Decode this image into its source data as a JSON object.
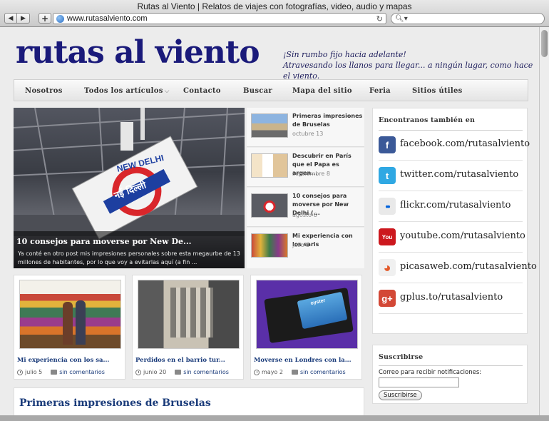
{
  "browser": {
    "window_title": "Rutas al Viento | Relatos de viajes con fotografías, video, audio y mapas",
    "url": "www.rutasalviento.com",
    "back_icon": "back-arrow-icon",
    "forward_icon": "forward-arrow-icon"
  },
  "site": {
    "title": "rutas al viento",
    "tagline_1": "¡Sin rumbo fijo hacia adelante!",
    "tagline_2": "Atravesando los llanos para llegar...  a ningún lugar, como hace el viento.",
    "title_color": "#1a1a7a"
  },
  "menu": {
    "nosotros": "Nosotros",
    "todos": "Todos los artículos",
    "contacto": "Contacto",
    "buscar": "Buscar",
    "mapa": "Mapa del sitio",
    "feria": "Feria",
    "sitios": "Sitios útiles"
  },
  "hero": {
    "sign_top": "NEW DELHI",
    "sign_hindi": "नई दिल्ली",
    "title": "10 consejos para moverse por New De...",
    "excerpt": "Ya conté en otro post mis impresiones personales sobre esta megaurbe de 13 millones de habitantes, por lo que voy a evitarlas aquí (a fin ..."
  },
  "side_posts": [
    {
      "title": "Primeras impresiones de Bruselas",
      "date": "octubre 13"
    },
    {
      "title": "Descubrir en París que el Papa es argen...",
      "date": "septiembre 8"
    },
    {
      "title": "10 consejos para moverse por New Delhi (...",
      "date": "agosto 6"
    },
    {
      "title": "Mi experiencia con los saris",
      "date": "julio 5"
    }
  ],
  "cards": [
    {
      "title": "Mi experiencia con los sa...",
      "date": "julio 5",
      "comments": "sin comentarios"
    },
    {
      "title": "Perdidos en el barrio tur...",
      "date": "junio 20",
      "comments": "sin comentarios"
    },
    {
      "title": "Moverse en Londres con la...",
      "date": "mayo 2",
      "comments": "sin comentarios",
      "card_label": "oyster"
    }
  ],
  "article": {
    "title": "Primeras impresiones de Bruselas"
  },
  "social": {
    "title": "Encontranos también en",
    "items": [
      {
        "label": "facebook.com/rutasalviento",
        "icon": "facebook-icon",
        "glyph": "f",
        "color": "#3b5998"
      },
      {
        "label": "twitter.com/rutasalviento",
        "icon": "twitter-icon",
        "glyph": "t",
        "color": "#2fa8e3"
      },
      {
        "label": "flickr.com/rutasalviento",
        "icon": "flickr-icon",
        "glyph": "••",
        "color": "#e9e9e9"
      },
      {
        "label": "youtube.com/rutasalviento",
        "icon": "youtube-icon",
        "glyph": "You",
        "color": "#cc181e"
      },
      {
        "label": "picasaweb.com/rutasalviento",
        "icon": "picasa-icon",
        "glyph": "◕",
        "color": "#f0f0f0"
      },
      {
        "label": "gplus.to/rutasalviento",
        "icon": "google-plus-icon",
        "glyph": "g+",
        "color": "#d34836"
      }
    ]
  },
  "subscribe": {
    "title": "Suscribirse",
    "label": "Correo para recibir notificaciones:",
    "button": "Suscribirse",
    "input_value": ""
  }
}
